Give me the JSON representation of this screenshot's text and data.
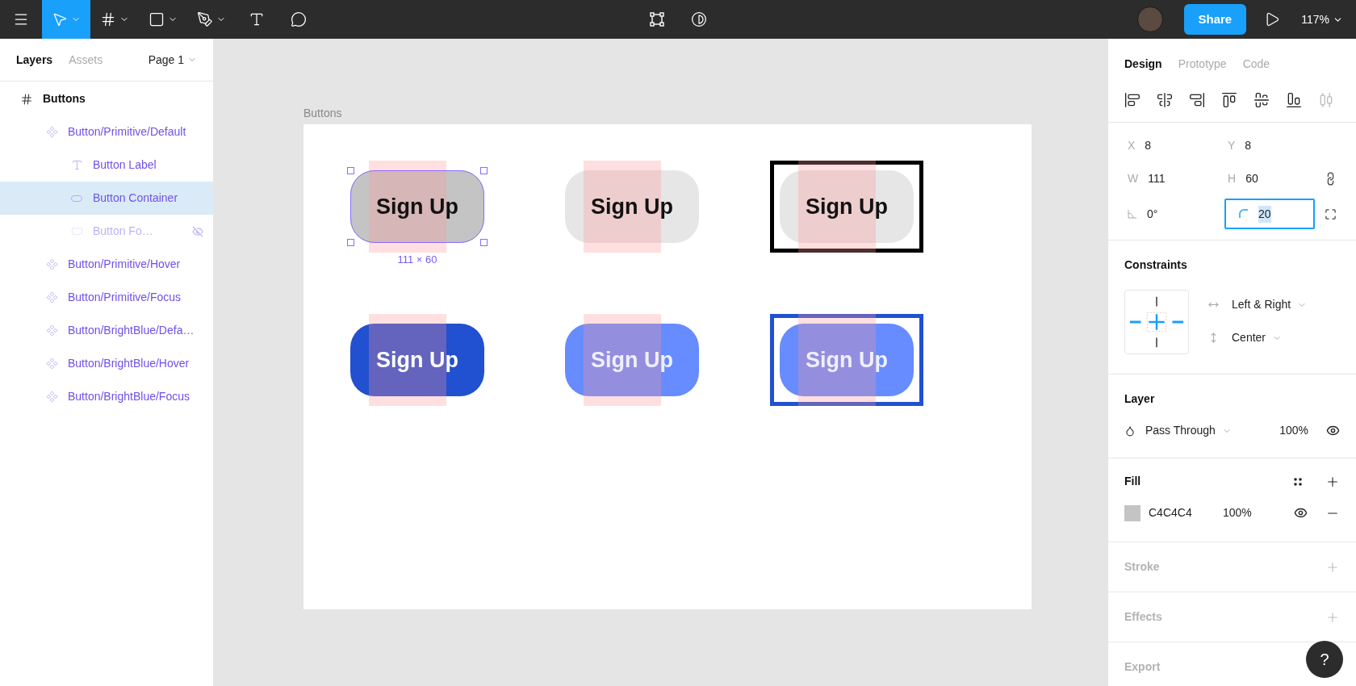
{
  "toolbar": {
    "tools": [
      {
        "kind": "menu",
        "selected": false,
        "dropdown": false
      },
      {
        "kind": "move",
        "selected": true,
        "dropdown": true
      },
      {
        "kind": "frame",
        "selected": false,
        "dropdown": true
      },
      {
        "kind": "rectangle",
        "selected": false,
        "dropdown": true
      },
      {
        "kind": "pen",
        "selected": false,
        "dropdown": true
      },
      {
        "kind": "text",
        "selected": false,
        "dropdown": false
      },
      {
        "kind": "comment",
        "selected": false,
        "dropdown": false
      }
    ],
    "center_tools": [
      {
        "kind": "component"
      },
      {
        "kind": "contrast"
      }
    ],
    "share": "Share",
    "zoom": "117%"
  },
  "left_panel": {
    "tabs": [
      {
        "label": "Layers",
        "selected": true
      },
      {
        "label": "Assets",
        "selected": false
      }
    ],
    "page": "Page 1",
    "layers": [
      {
        "kind": "frame",
        "name": "Buttons",
        "selected": false,
        "hidden": false,
        "children": [
          {
            "kind": "component",
            "name": "Button/Primitive/Default",
            "selected": false,
            "hidden": false,
            "children": [
              {
                "kind": "text",
                "name": "Button Label",
                "selected": false,
                "hidden": false
              },
              {
                "kind": "rounded-rectangle",
                "name": "Button Container",
                "selected": true,
                "hidden": false
              },
              {
                "kind": "rectangle",
                "name": "Button Fo…",
                "selected": false,
                "hidden": true
              }
            ]
          },
          {
            "kind": "component",
            "name": "Button/Primitive/Hover",
            "selected": false,
            "hidden": false
          },
          {
            "kind": "component",
            "name": "Button/Primitive/Focus",
            "selected": false,
            "hidden": false
          },
          {
            "kind": "component",
            "name": "Button/BrightBlue/Defa…",
            "selected": false,
            "hidden": false
          },
          {
            "kind": "component",
            "name": "Button/BrightBlue/Hover",
            "selected": false,
            "hidden": false
          },
          {
            "kind": "component",
            "name": "Button/BrightBlue/Focus",
            "selected": false,
            "hidden": false
          }
        ]
      }
    ]
  },
  "canvas": {
    "frame_title": "Buttons",
    "buttons": [
      {
        "kind": "primitive-default",
        "label": "Sign Up",
        "selected": true,
        "size": "111 × 60"
      },
      {
        "kind": "primitive-hover",
        "label": "Sign Up",
        "selected": false
      },
      {
        "kind": "primitive-focus",
        "label": "Sign Up",
        "selected": false
      },
      {
        "kind": "blue-default",
        "label": "Sign Up",
        "selected": false
      },
      {
        "kind": "blue-hover",
        "label": "Sign Up",
        "selected": false
      },
      {
        "kind": "blue-focus",
        "label": "Sign Up",
        "selected": false
      }
    ]
  },
  "design_panel": {
    "tabs": [
      {
        "label": "Design",
        "selected": true
      },
      {
        "label": "Prototype",
        "selected": false
      },
      {
        "label": "Code",
        "selected": false
      }
    ],
    "align_tools": [
      {
        "kind": "left"
      },
      {
        "kind": "center-h"
      },
      {
        "kind": "right"
      },
      {
        "kind": "top"
      },
      {
        "kind": "center-v"
      },
      {
        "kind": "bottom"
      },
      {
        "kind": "distribute"
      }
    ],
    "fields": [
      {
        "label": "X",
        "value": "8"
      },
      {
        "label": "Y",
        "value": "8"
      },
      {
        "label": "W",
        "value": "111"
      },
      {
        "label": "H",
        "value": "60"
      }
    ],
    "rotation": "0°",
    "radius": {
      "value": "20",
      "focused": true
    },
    "constraints": {
      "title": "Constraints",
      "horizontal": "Left & Right",
      "vertical": "Center"
    },
    "layer": {
      "title": "Layer",
      "blend": "Pass Through",
      "opacity": "100%"
    },
    "fill": {
      "title": "Fill",
      "color": "#c4c4c4",
      "hex": "C4C4C4",
      "opacity": "100%"
    },
    "empty_sections": [
      {
        "title": "Stroke",
        "has_add": true
      },
      {
        "title": "Effects",
        "has_add": true
      },
      {
        "title": "Export"
      }
    ]
  },
  "help": "?"
}
